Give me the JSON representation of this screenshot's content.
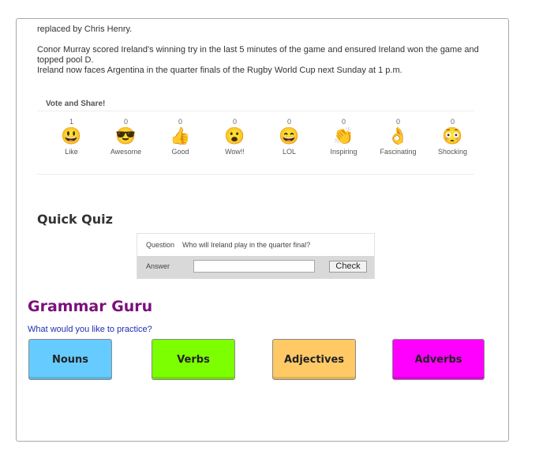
{
  "article": {
    "line_top": "replaced by Chris Henry.",
    "para1": "Conor Murray scored Ireland's winning try in the last 5 minutes of the game and ensured Ireland won the game and topped pool D.",
    "para2": "Ireland now faces Argentina in the quarter finals of the Rugby World Cup next Sunday at 1 p.m."
  },
  "vote": {
    "title": "Vote and Share!",
    "reactions": [
      {
        "count": "1",
        "emoji": "😃",
        "label": "Like",
        "icon": "grinning-face-icon"
      },
      {
        "count": "0",
        "emoji": "😎",
        "label": "Awesome",
        "icon": "sunglasses-face-icon"
      },
      {
        "count": "0",
        "emoji": "👍",
        "label": "Good",
        "icon": "thumbs-up-icon"
      },
      {
        "count": "0",
        "emoji": "😮",
        "label": "Wow!!",
        "icon": "surprised-face-icon"
      },
      {
        "count": "0",
        "emoji": "😄",
        "label": "LOL",
        "icon": "laughing-face-icon"
      },
      {
        "count": "0",
        "emoji": "👏",
        "label": "Inspiring",
        "icon": "clapping-hands-icon"
      },
      {
        "count": "0",
        "emoji": "👌",
        "label": "Fascinating",
        "icon": "ok-hand-icon"
      },
      {
        "count": "0",
        "emoji": "😳",
        "label": "Shocking",
        "icon": "flushed-face-icon"
      }
    ]
  },
  "quiz": {
    "title": "Quick Quiz",
    "question_label": "Question",
    "question_text": "Who will Ireland play in the quarter final?",
    "answer_label": "Answer",
    "answer_value": "",
    "check_label": "Check"
  },
  "grammar": {
    "title": "Grammar Guru",
    "subtitle": "What would you like to practice?",
    "buttons": [
      {
        "label": "Nouns",
        "color": "#66ccff"
      },
      {
        "label": "Verbs",
        "color": "#7cff00"
      },
      {
        "label": "Adjectives",
        "color": "#ffc966"
      },
      {
        "label": "Adverbs",
        "color": "#ff00ff"
      }
    ]
  }
}
